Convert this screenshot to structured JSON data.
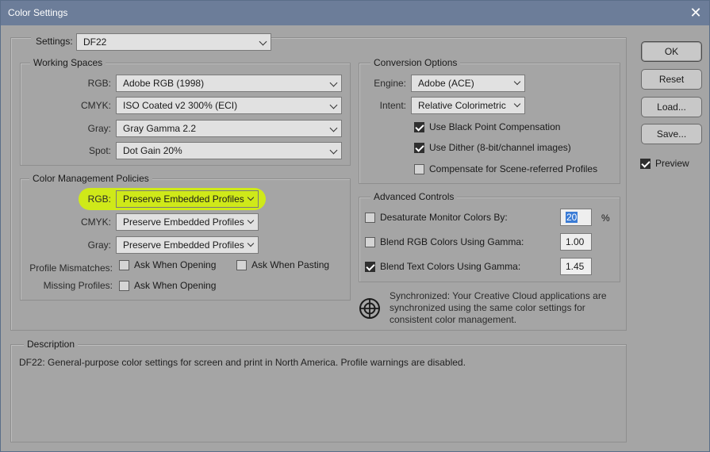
{
  "window": {
    "title": "Color Settings"
  },
  "settings": {
    "label": "Settings:",
    "value": "DF22"
  },
  "working_spaces": {
    "legend": "Working Spaces",
    "rgb": {
      "label": "RGB:",
      "value": "Adobe RGB (1998)"
    },
    "cmyk": {
      "label": "CMYK:",
      "value": "ISO Coated v2 300% (ECI)"
    },
    "gray": {
      "label": "Gray:",
      "value": "Gray Gamma 2.2"
    },
    "spot": {
      "label": "Spot:",
      "value": "Dot Gain 20%"
    }
  },
  "policies": {
    "legend": "Color Management Policies",
    "rgb": {
      "label": "RGB:",
      "value": "Preserve Embedded Profiles"
    },
    "cmyk": {
      "label": "CMYK:",
      "value": "Preserve Embedded Profiles"
    },
    "gray": {
      "label": "Gray:",
      "value": "Preserve Embedded Profiles"
    },
    "mismatch_label": "Profile Mismatches:",
    "mismatch_open": "Ask When Opening",
    "mismatch_paste": "Ask When Pasting",
    "missing_label": "Missing Profiles:",
    "missing_open": "Ask When Opening"
  },
  "conversion": {
    "legend": "Conversion Options",
    "engine_label": "Engine:",
    "engine_value": "Adobe (ACE)",
    "intent_label": "Intent:",
    "intent_value": "Relative Colorimetric",
    "bpc": "Use Black Point Compensation",
    "dither": "Use Dither (8-bit/channel images)",
    "scene": "Compensate for Scene-referred Profiles"
  },
  "advanced": {
    "legend": "Advanced Controls",
    "desaturate": "Desaturate Monitor Colors By:",
    "desaturate_value": "20",
    "percent": "%",
    "blend_rgb": "Blend RGB Colors Using Gamma:",
    "blend_rgb_value": "1.00",
    "blend_text": "Blend Text Colors Using Gamma:",
    "blend_text_value": "1.45"
  },
  "sync": {
    "text1": "Synchronized: Your Creative Cloud applications are",
    "text2": "synchronized using the same color settings for",
    "text3": "consistent color management."
  },
  "description": {
    "legend": "Description",
    "text": "DF22:  General-purpose color settings for screen and print in North America. Profile warnings are disabled."
  },
  "buttons": {
    "ok": "OK",
    "reset": "Reset",
    "load": "Load...",
    "save": "Save...",
    "preview": "Preview"
  },
  "colors": {
    "titlebar": "#6c7d99",
    "highlight": "#d6f500",
    "dialog_bg": "#a5a5a5"
  }
}
